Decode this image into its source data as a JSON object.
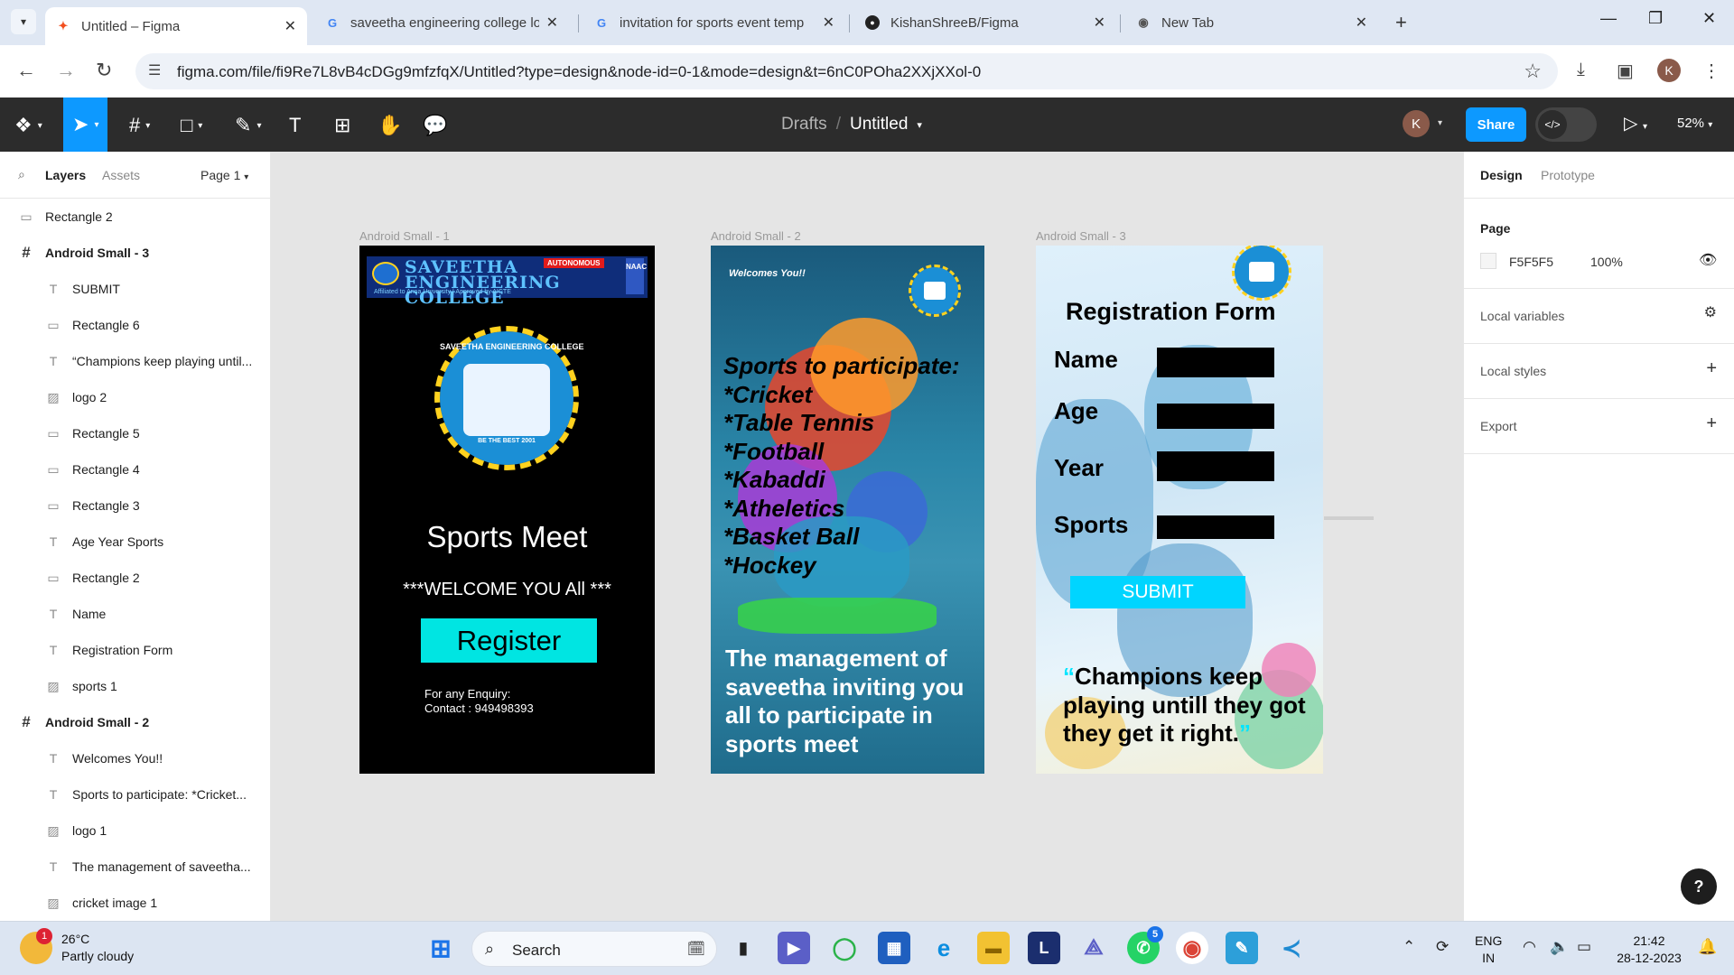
{
  "browser": {
    "tabs": [
      {
        "title": "Untitled – Figma",
        "favicon": "F"
      },
      {
        "title": "saveetha engineering college lo",
        "favicon": "G"
      },
      {
        "title": "invitation for sports event temp",
        "favicon": "G"
      },
      {
        "title": "KishanShreeB/Figma",
        "favicon": "GH"
      },
      {
        "title": "New Tab",
        "favicon": "C"
      }
    ],
    "url": "figma.com/file/fi9Re7L8vB4cDGg9mfzfqX/Untitled?type=design&node-id=0-1&mode=design&t=6nC0POha2XXjXXol-0",
    "profile_initial": "K"
  },
  "figma": {
    "breadcrumb": {
      "drafts": "Drafts",
      "slash": "/",
      "file": "Untitled"
    },
    "avatar_initial": "K",
    "share": "Share",
    "zoom": "52%",
    "left_panel": {
      "tab_layers": "Layers",
      "tab_assets": "Assets",
      "page": "Page 1",
      "layers": [
        {
          "name": "Rectangle 2",
          "type": "rect",
          "indent": 0
        },
        {
          "name": "Android Small - 3",
          "type": "frame",
          "indent": 0
        },
        {
          "name": "SUBMIT",
          "type": "text",
          "indent": 1
        },
        {
          "name": "Rectangle 6",
          "type": "rect",
          "indent": 1
        },
        {
          "name": "“Champions keep playing until...",
          "type": "text",
          "indent": 1
        },
        {
          "name": "logo 2",
          "type": "image",
          "indent": 1
        },
        {
          "name": "Rectangle 5",
          "type": "rect",
          "indent": 1
        },
        {
          "name": "Rectangle 4",
          "type": "rect",
          "indent": 1
        },
        {
          "name": "Rectangle 3",
          "type": "rect",
          "indent": 1
        },
        {
          "name": "Age Year Sports",
          "type": "text",
          "indent": 1
        },
        {
          "name": "Rectangle 2",
          "type": "rect",
          "indent": 1
        },
        {
          "name": "Name",
          "type": "text",
          "indent": 1
        },
        {
          "name": "Registration Form",
          "type": "text",
          "indent": 1
        },
        {
          "name": "sports 1",
          "type": "image",
          "indent": 1
        },
        {
          "name": "Android Small - 2",
          "type": "frame",
          "indent": 0
        },
        {
          "name": "Welcomes You!!",
          "type": "text",
          "indent": 1
        },
        {
          "name": "Sports to participate: *Cricket...",
          "type": "text",
          "indent": 1
        },
        {
          "name": "logo 1",
          "type": "image",
          "indent": 1
        },
        {
          "name": "The management of saveetha...",
          "type": "text",
          "indent": 1
        },
        {
          "name": "cricket image 1",
          "type": "image",
          "indent": 1
        }
      ]
    },
    "canvas": {
      "frames": [
        {
          "label": "Android Small - 1",
          "college_name": "SAVEETHA ENGINEERING COLLEGE",
          "college_affiliation": "Affiliated to Anna University | Approved by AICTE",
          "autonomous": "AUTONOMOUS",
          "accreditation": "NAAC",
          "seal_top": "SAVEETHA ENGINEERING COLLEGE",
          "seal_bottom": "BE THE BEST 2001",
          "title": "Sports Meet",
          "welcome": "***WELCOME YOU All ***",
          "register": "Register",
          "enquiry_line1": "For any Enquiry:",
          "enquiry_line2": "Contact : 949498393"
        },
        {
          "label": "Android Small - 2",
          "welcomes": "Welcomes You!!",
          "sports": "Sports to participate:\n*Cricket\n*Table Tennis\n*Football\n*Kabaddi\n*Atheletics\n*Basket Ball\n*Hockey",
          "management": "The management of saveetha inviting you all to participate in sports meet"
        },
        {
          "label": "Android Small - 3",
          "form_title": "Registration Form",
          "fields": [
            "Name",
            "Age",
            "Year",
            "Sports"
          ],
          "submit": "SUBMIT",
          "quote_open": "“",
          "quote": "Champions keep playing untill they got they get it right.",
          "quote_close": "”"
        }
      ]
    },
    "right_panel": {
      "tab_design": "Design",
      "tab_prototype": "Prototype",
      "page_heading": "Page",
      "page_color": "F5F5F5",
      "page_opacity": "100%",
      "local_variables": "Local variables",
      "local_styles": "Local styles",
      "export": "Export"
    },
    "help": "?"
  },
  "taskbar": {
    "weather_temp": "26°C",
    "weather_desc": "Partly cloudy",
    "weather_badge": "1",
    "search": "Search",
    "whatsapp_badge": "5",
    "lang_line1": "ENG",
    "lang_line2": "IN",
    "time": "21:42",
    "date": "28-12-2023"
  },
  "colors": {
    "figma_blue": "#0d99ff",
    "register_cyan": "#00e5e2",
    "submit_cyan": "#00d5ff",
    "figma_dark": "#2c2c2c"
  }
}
